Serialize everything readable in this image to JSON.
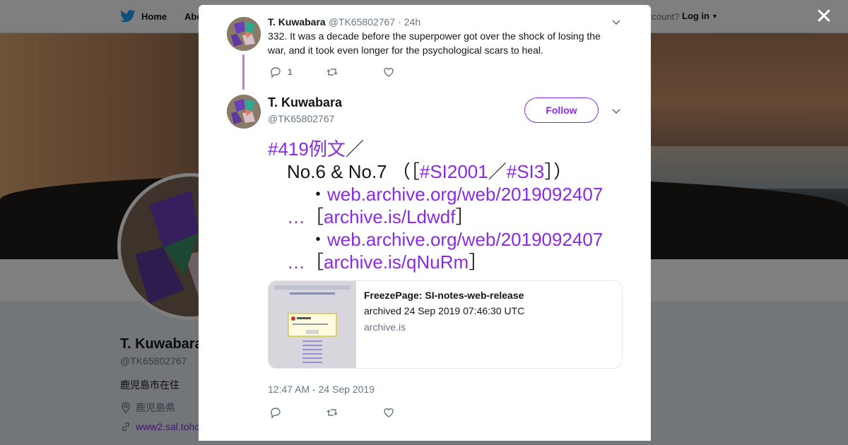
{
  "nav": {
    "home_label": "Home",
    "about_label": "Abo",
    "account_prompt": "ccount?",
    "login_label": "Log in"
  },
  "profile": {
    "name": "T. Kuwabara",
    "handle": "@TK65802767",
    "bio": "鹿児島市在住",
    "location": "鹿児島県",
    "url": "www2.sal.toho"
  },
  "modal": {
    "close_label": "✕",
    "parent_tweet": {
      "name": "T. Kuwabara",
      "handle": "@TK65802767",
      "separator": "·",
      "time": "24h",
      "text": "332. It was a decade before the superpower got over the shock of losing the war, and it took even longer for the psychological scars to heal.",
      "reply_count": "1"
    },
    "main_tweet": {
      "name": "T. Kuwabara",
      "handle": "@TK65802767",
      "follow_label": "Follow",
      "lines": {
        "l1_hashtag": "#419例文",
        "l1_rest": "／",
        "l2_pre": "No.6 & No.7 （［",
        "l2_tag1": "#SI2001",
        "l2_mid": "／",
        "l2_tag2": "#SI3",
        "l2_post": "］）",
        "l3_bullet": "・",
        "l3_link": "web.archive.org/web/2019092407",
        "l4_ellipsis": "…",
        "l4_open": "［",
        "l4_link": "archive.is/Ldwdf",
        "l4_close": "］",
        "l5_bullet": "・",
        "l5_link": "web.archive.org/web/2019092407",
        "l6_ellipsis": "…",
        "l6_open": "［",
        "l6_link": "archive.is/qNuRm",
        "l6_close": "］"
      },
      "card": {
        "title": "FreezePage: SI-notes-web-release",
        "description": "archived 24 Sep 2019 07:46:30 UTC",
        "domain": "archive.is"
      },
      "timestamp": "12:47 AM - 24 Sep 2019"
    }
  },
  "colors": {
    "accent": "#8a2be2",
    "thread_line": "#c678dd",
    "muted": "#657786"
  }
}
